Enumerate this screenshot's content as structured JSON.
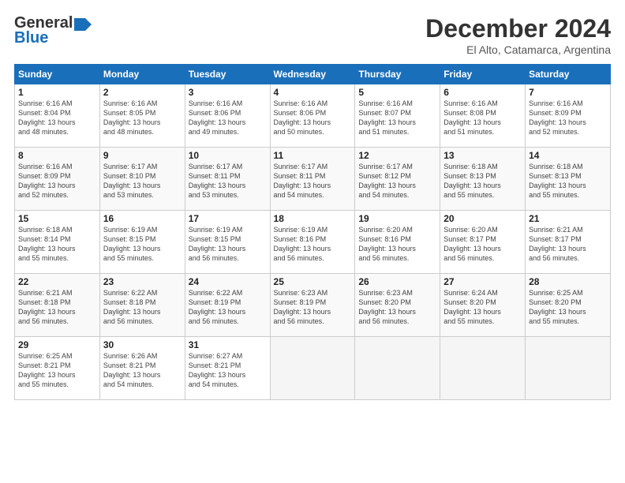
{
  "header": {
    "logo_line1": "General",
    "logo_line2": "Blue",
    "title": "December 2024",
    "location": "El Alto, Catamarca, Argentina"
  },
  "columns": [
    "Sunday",
    "Monday",
    "Tuesday",
    "Wednesday",
    "Thursday",
    "Friday",
    "Saturday"
  ],
  "weeks": [
    [
      {
        "day": "1",
        "info": "Sunrise: 6:16 AM\nSunset: 8:04 PM\nDaylight: 13 hours\nand 48 minutes."
      },
      {
        "day": "2",
        "info": "Sunrise: 6:16 AM\nSunset: 8:05 PM\nDaylight: 13 hours\nand 48 minutes."
      },
      {
        "day": "3",
        "info": "Sunrise: 6:16 AM\nSunset: 8:06 PM\nDaylight: 13 hours\nand 49 minutes."
      },
      {
        "day": "4",
        "info": "Sunrise: 6:16 AM\nSunset: 8:06 PM\nDaylight: 13 hours\nand 50 minutes."
      },
      {
        "day": "5",
        "info": "Sunrise: 6:16 AM\nSunset: 8:07 PM\nDaylight: 13 hours\nand 51 minutes."
      },
      {
        "day": "6",
        "info": "Sunrise: 6:16 AM\nSunset: 8:08 PM\nDaylight: 13 hours\nand 51 minutes."
      },
      {
        "day": "7",
        "info": "Sunrise: 6:16 AM\nSunset: 8:09 PM\nDaylight: 13 hours\nand 52 minutes."
      }
    ],
    [
      {
        "day": "8",
        "info": "Sunrise: 6:16 AM\nSunset: 8:09 PM\nDaylight: 13 hours\nand 52 minutes."
      },
      {
        "day": "9",
        "info": "Sunrise: 6:17 AM\nSunset: 8:10 PM\nDaylight: 13 hours\nand 53 minutes."
      },
      {
        "day": "10",
        "info": "Sunrise: 6:17 AM\nSunset: 8:11 PM\nDaylight: 13 hours\nand 53 minutes."
      },
      {
        "day": "11",
        "info": "Sunrise: 6:17 AM\nSunset: 8:11 PM\nDaylight: 13 hours\nand 54 minutes."
      },
      {
        "day": "12",
        "info": "Sunrise: 6:17 AM\nSunset: 8:12 PM\nDaylight: 13 hours\nand 54 minutes."
      },
      {
        "day": "13",
        "info": "Sunrise: 6:18 AM\nSunset: 8:13 PM\nDaylight: 13 hours\nand 55 minutes."
      },
      {
        "day": "14",
        "info": "Sunrise: 6:18 AM\nSunset: 8:13 PM\nDaylight: 13 hours\nand 55 minutes."
      }
    ],
    [
      {
        "day": "15",
        "info": "Sunrise: 6:18 AM\nSunset: 8:14 PM\nDaylight: 13 hours\nand 55 minutes."
      },
      {
        "day": "16",
        "info": "Sunrise: 6:19 AM\nSunset: 8:15 PM\nDaylight: 13 hours\nand 55 minutes."
      },
      {
        "day": "17",
        "info": "Sunrise: 6:19 AM\nSunset: 8:15 PM\nDaylight: 13 hours\nand 56 minutes."
      },
      {
        "day": "18",
        "info": "Sunrise: 6:19 AM\nSunset: 8:16 PM\nDaylight: 13 hours\nand 56 minutes."
      },
      {
        "day": "19",
        "info": "Sunrise: 6:20 AM\nSunset: 8:16 PM\nDaylight: 13 hours\nand 56 minutes."
      },
      {
        "day": "20",
        "info": "Sunrise: 6:20 AM\nSunset: 8:17 PM\nDaylight: 13 hours\nand 56 minutes."
      },
      {
        "day": "21",
        "info": "Sunrise: 6:21 AM\nSunset: 8:17 PM\nDaylight: 13 hours\nand 56 minutes."
      }
    ],
    [
      {
        "day": "22",
        "info": "Sunrise: 6:21 AM\nSunset: 8:18 PM\nDaylight: 13 hours\nand 56 minutes."
      },
      {
        "day": "23",
        "info": "Sunrise: 6:22 AM\nSunset: 8:18 PM\nDaylight: 13 hours\nand 56 minutes."
      },
      {
        "day": "24",
        "info": "Sunrise: 6:22 AM\nSunset: 8:19 PM\nDaylight: 13 hours\nand 56 minutes."
      },
      {
        "day": "25",
        "info": "Sunrise: 6:23 AM\nSunset: 8:19 PM\nDaylight: 13 hours\nand 56 minutes."
      },
      {
        "day": "26",
        "info": "Sunrise: 6:23 AM\nSunset: 8:20 PM\nDaylight: 13 hours\nand 56 minutes."
      },
      {
        "day": "27",
        "info": "Sunrise: 6:24 AM\nSunset: 8:20 PM\nDaylight: 13 hours\nand 55 minutes."
      },
      {
        "day": "28",
        "info": "Sunrise: 6:25 AM\nSunset: 8:20 PM\nDaylight: 13 hours\nand 55 minutes."
      }
    ],
    [
      {
        "day": "29",
        "info": "Sunrise: 6:25 AM\nSunset: 8:21 PM\nDaylight: 13 hours\nand 55 minutes."
      },
      {
        "day": "30",
        "info": "Sunrise: 6:26 AM\nSunset: 8:21 PM\nDaylight: 13 hours\nand 54 minutes."
      },
      {
        "day": "31",
        "info": "Sunrise: 6:27 AM\nSunset: 8:21 PM\nDaylight: 13 hours\nand 54 minutes."
      },
      null,
      null,
      null,
      null
    ]
  ]
}
